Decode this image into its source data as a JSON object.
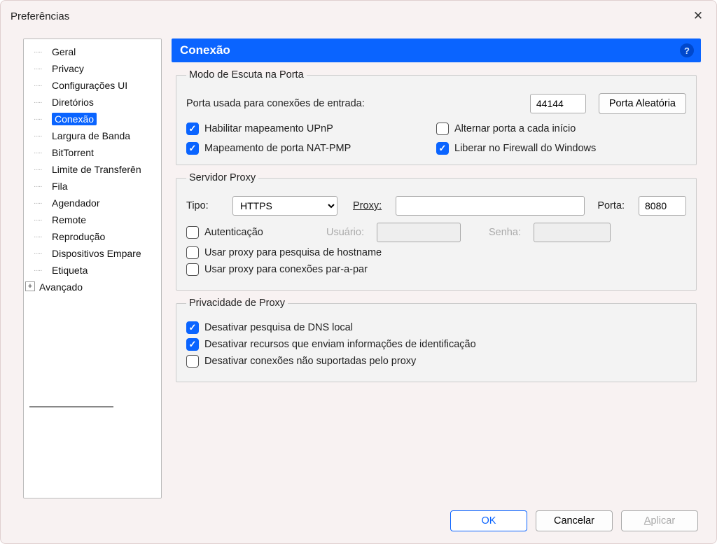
{
  "window": {
    "title": "Preferências"
  },
  "sidebar": {
    "items": [
      {
        "label": "Geral"
      },
      {
        "label": "Privacy"
      },
      {
        "label": "Configurações UI"
      },
      {
        "label": "Diretórios"
      },
      {
        "label": "Conexão",
        "selected": true
      },
      {
        "label": "Largura de Banda"
      },
      {
        "label": "BitTorrent"
      },
      {
        "label": "Limite de Transferên"
      },
      {
        "label": "Fila"
      },
      {
        "label": "Agendador"
      },
      {
        "label": "Remote"
      },
      {
        "label": "Reprodução"
      },
      {
        "label": "Dispositivos Empare"
      },
      {
        "label": "Etiqueta"
      },
      {
        "label": "Avançado",
        "expandable": true
      }
    ]
  },
  "panel": {
    "title": "Conexão"
  },
  "listen": {
    "legend": "Modo de Escuta na Porta",
    "port_label": "Porta usada para conexões de entrada:",
    "port_value": "44144",
    "random_btn": "Porta Aleatória",
    "upnp": "Habilitar mapeamento UPnP",
    "alternate": "Alternar porta a cada início",
    "natpmp": "Mapeamento de porta NAT-PMP",
    "firewall": "Liberar no Firewall do Windows"
  },
  "proxy": {
    "legend": "Servidor Proxy",
    "type_label": "Tipo:",
    "type_value": "HTTPS",
    "proxy_label": "Proxy:",
    "proxy_value": "",
    "port_label": "Porta:",
    "port_value": "8080",
    "auth": "Autenticação",
    "user_label": "Usuário:",
    "pass_label": "Senha:",
    "hostname": "Usar proxy para pesquisa de hostname",
    "p2p": "Usar proxy para conexões par-a-par"
  },
  "privacy": {
    "legend": "Privacidade de Proxy",
    "dns": "Desativar pesquisa de DNS local",
    "ident": "Desativar recursos que enviam informações de identificação",
    "unsupported": "Desativar conexões não suportadas pelo proxy"
  },
  "footer": {
    "ok": "OK",
    "cancel": "Cancelar",
    "apply": "Aplicar"
  }
}
